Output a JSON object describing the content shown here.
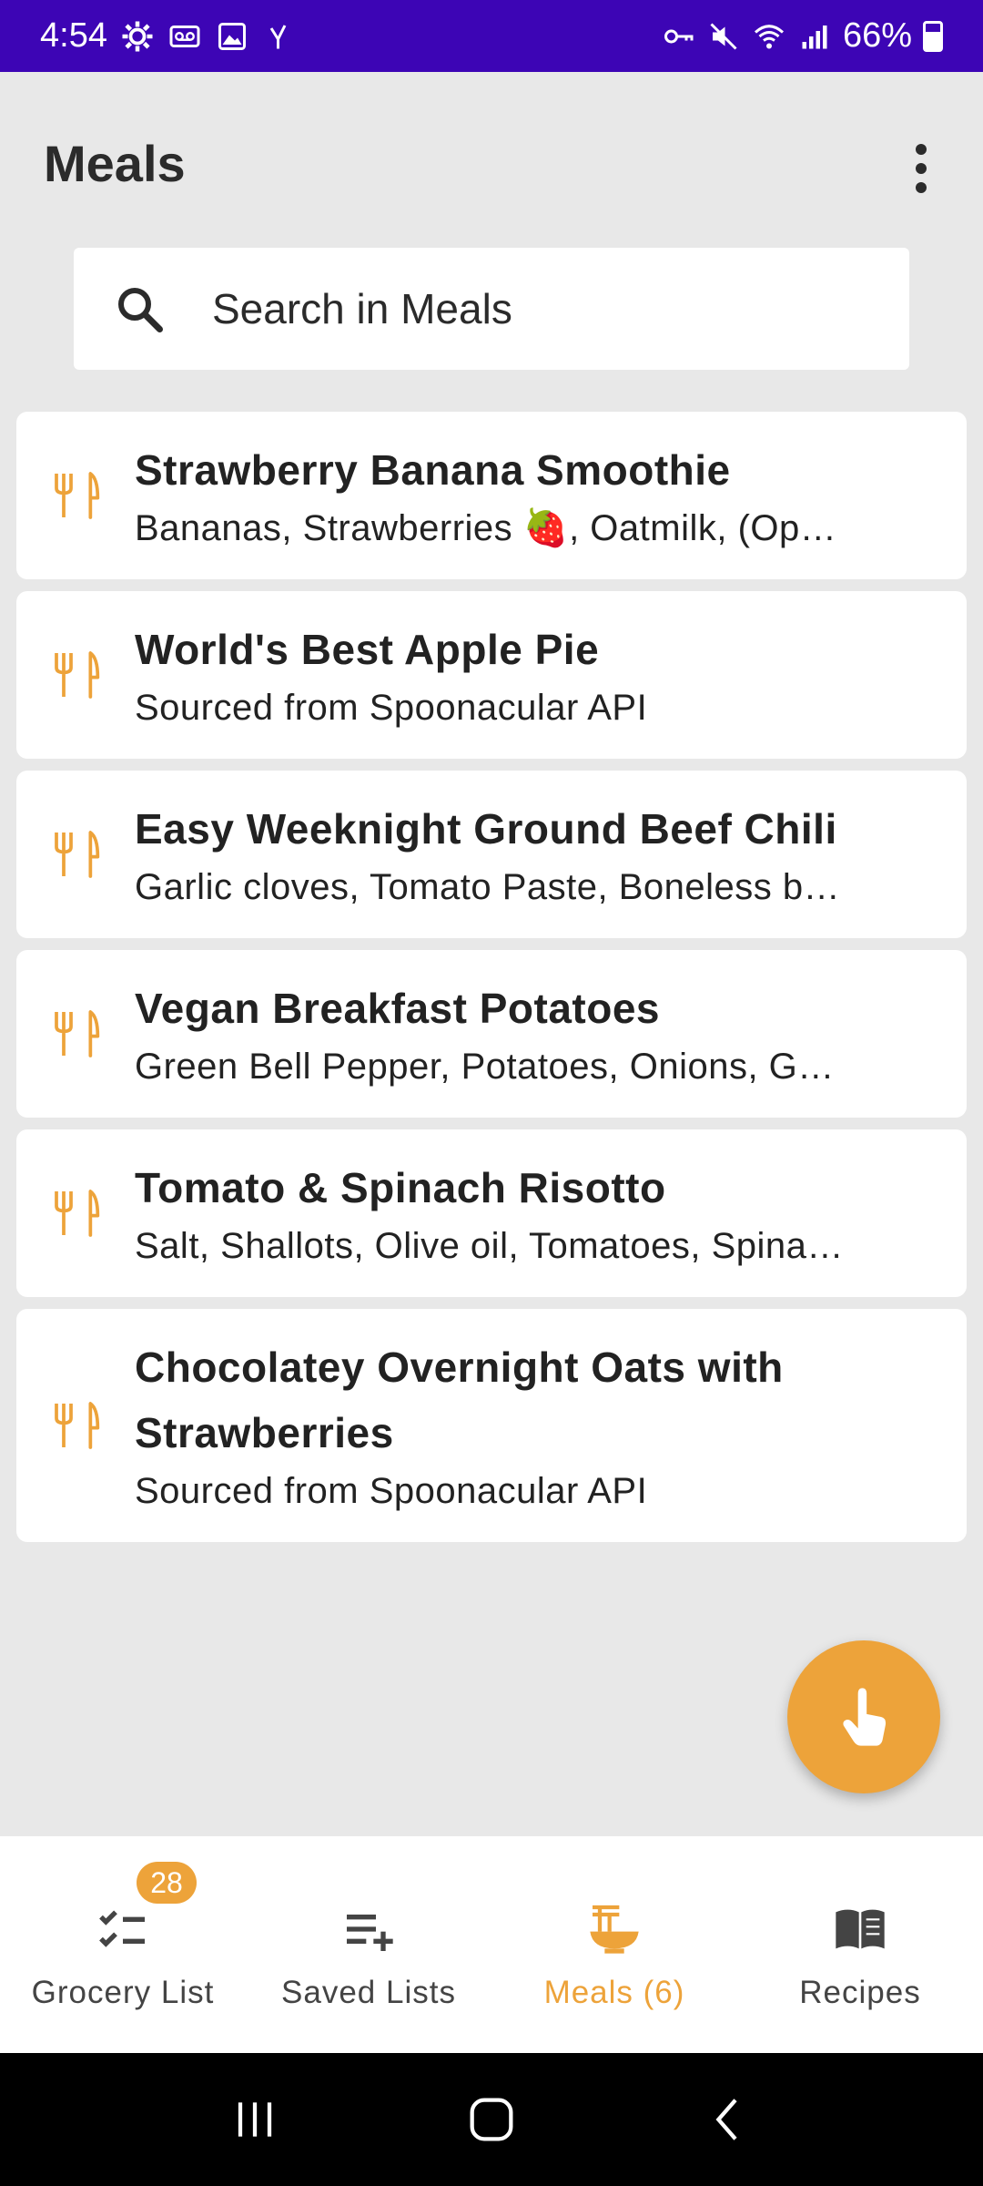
{
  "status_bar": {
    "time": "4:54",
    "battery": "66%",
    "left_icons": [
      "settings-icon",
      "voicemail-icon",
      "image-icon",
      "signal-y-icon"
    ],
    "right_icons": [
      "vpn-key-icon",
      "mute-icon",
      "wifi-icon",
      "cellular-icon",
      "battery-icon"
    ]
  },
  "header": {
    "title": "Meals",
    "more_icon": "more-vert-icon"
  },
  "search": {
    "placeholder": "Search in Meals",
    "icon": "search-icon"
  },
  "meals": [
    {
      "title": "Strawberry Banana Smoothie",
      "subtitle": "Bananas, Strawberries 🍓, Oatmilk, (Optional Ingredients)"
    },
    {
      "title": "World's Best Apple Pie",
      "subtitle": "Sourced from Spoonacular API"
    },
    {
      "title": "Easy Weeknight Ground Beef Chili",
      "subtitle": "Garlic cloves, Tomato Paste, Boneless beef"
    },
    {
      "title": "Vegan Breakfast Potatoes",
      "subtitle": "Green Bell Pepper, Potatoes, Onions, Garlic"
    },
    {
      "title": "Tomato & Spinach Risotto",
      "subtitle": "Salt, Shallots, Olive oil, Tomatoes, Spinach"
    },
    {
      "title": "Chocolatey Overnight Oats with Strawberries",
      "subtitle": "Sourced from Spoonacular API"
    }
  ],
  "fab": {
    "icon": "touch-icon"
  },
  "bottom_nav": {
    "items": [
      {
        "label": "Grocery List",
        "icon": "checklist-icon",
        "badge": "28"
      },
      {
        "label": "Saved Lists",
        "icon": "playlist-add-icon"
      },
      {
        "label": "Meals (6)",
        "icon": "ramen-bowl-icon",
        "active": true
      },
      {
        "label": "Recipes",
        "icon": "book-icon"
      }
    ]
  },
  "colors": {
    "status_bar": "#3d05b5",
    "accent": "#eda33a",
    "background": "#e8e8e8",
    "card": "#ffffff",
    "text": "#222222"
  }
}
